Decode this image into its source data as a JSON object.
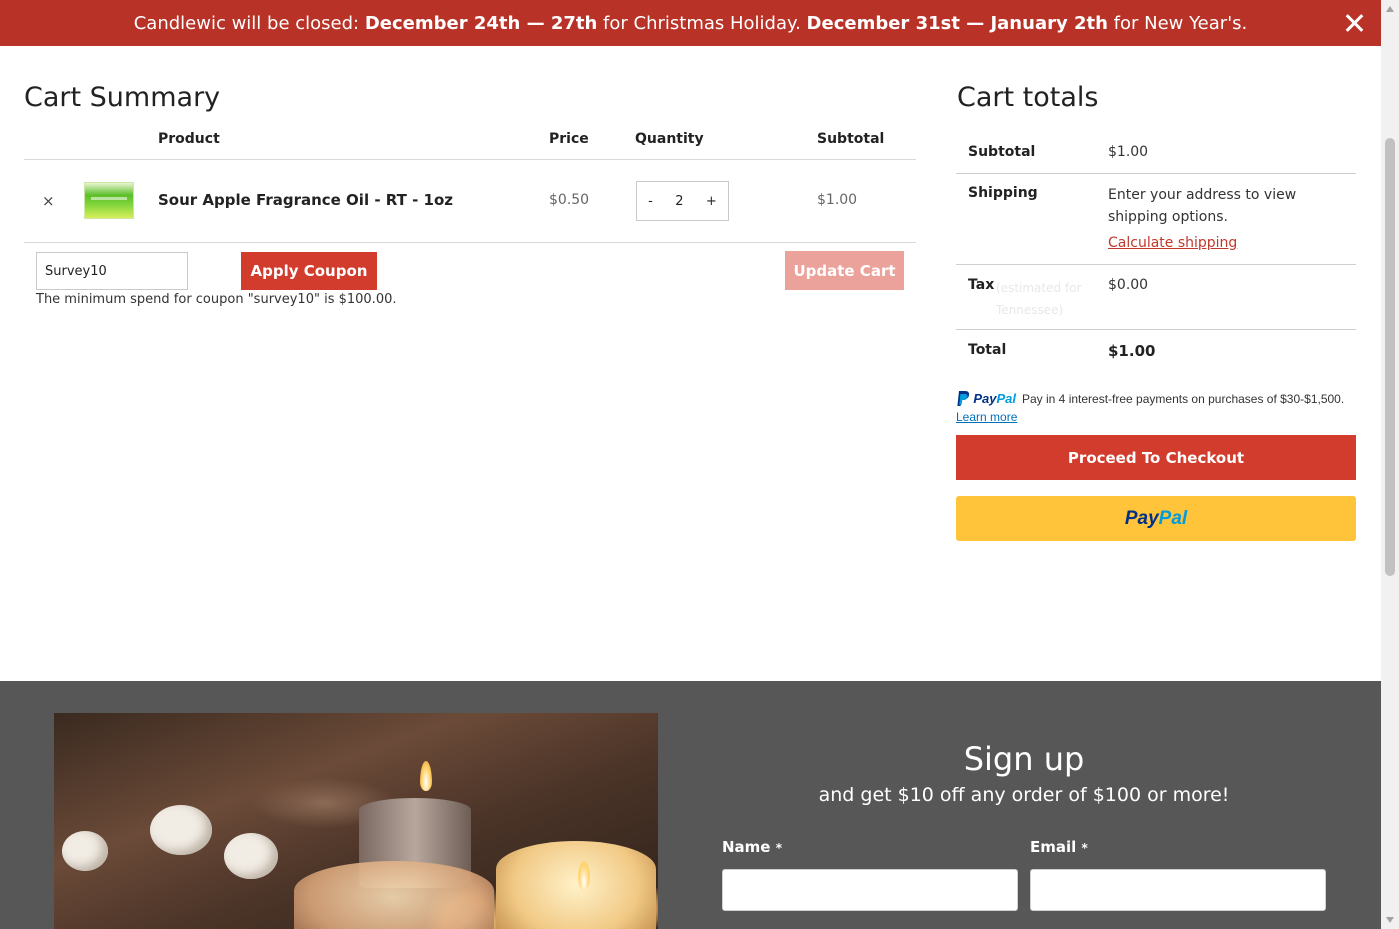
{
  "banner": {
    "lead": "Candlewic will be closed: ",
    "dates1": "December 24th — 27th",
    "reason1": " for Christmas Holiday. ",
    "dates2": "December 31st — January 2th",
    "reason2": " for New Year's."
  },
  "cart_summary": {
    "title": "Cart Summary",
    "columns": {
      "product": "Product",
      "price": "Price",
      "quantity": "Quantity",
      "subtotal": "Subtotal"
    },
    "items": [
      {
        "remove_icon": "×",
        "name": "Sour Apple Fragrance Oil - RT - 1oz",
        "price": "$0.50",
        "qty_minus": "-",
        "quantity": "2",
        "qty_plus": "+",
        "subtotal": "$1.00"
      }
    ],
    "coupon_value": "Survey10",
    "apply_coupon_label": "Apply Coupon",
    "update_cart_label": "Update Cart",
    "coupon_message": "The minimum spend for coupon \"survey10\" is $100.00."
  },
  "cart_totals": {
    "title": "Cart totals",
    "subtotal_label": "Subtotal",
    "subtotal_value": "$1.00",
    "shipping_label": "Shipping",
    "shipping_text": "Enter your address to view shipping options.",
    "calculate_shipping": "Calculate shipping",
    "tax_label": "Tax",
    "tax_estimate": "(estimated for Tennessee)",
    "tax_value": "$0.00",
    "total_label": "Total",
    "total_value": "$1.00",
    "paypal_msg_brand_a": "Pay",
    "paypal_msg_brand_b": "Pal",
    "paypal_msg_text": "Pay in 4 interest-free payments on purchases of $30-$1,500.",
    "learn_more": "Learn more",
    "checkout_label": "Proceed To Checkout",
    "paypal_btn_a": "Pay",
    "paypal_btn_b": "Pal"
  },
  "signup": {
    "title": "Sign up",
    "subtitle": "and get $10 off any order of $100 or more!",
    "name_label": "Name",
    "email_label": "Email",
    "required_mark": "*"
  },
  "colors": {
    "banner": "#b83227",
    "primary_button": "#d23c2c",
    "update_button_disabled": "#eba29b",
    "paypal_yellow": "#ffc439",
    "footer_bg": "#575757"
  },
  "icons": {
    "banner_close": "close-icon",
    "remove_item": "remove-item-icon",
    "paypal": "paypal-icon"
  }
}
